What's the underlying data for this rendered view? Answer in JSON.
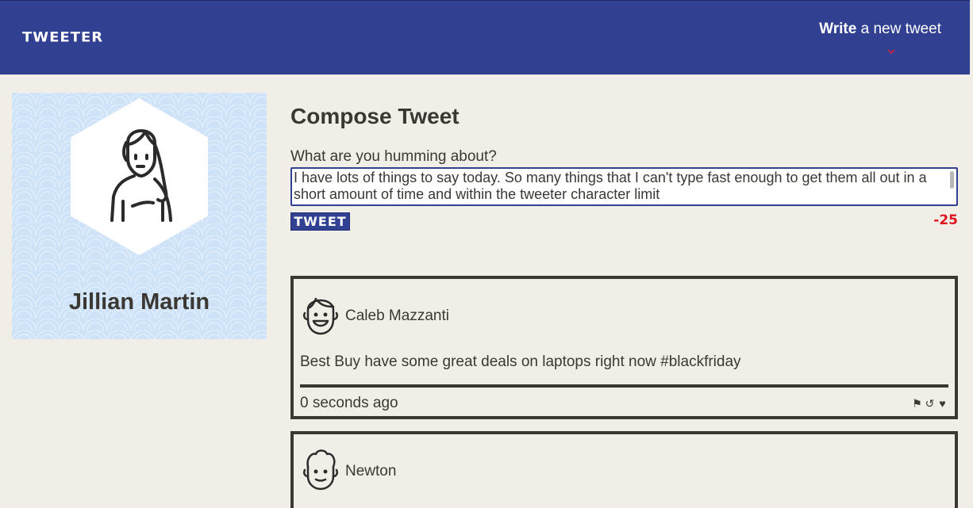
{
  "nav": {
    "brand": "TWEETER",
    "write_bold": "Write",
    "write_rest": " a new tweet",
    "write_icon": "chevron-down-icon"
  },
  "profile": {
    "name": "Jillian Martin",
    "avatar_icon": "woman-avatar-icon",
    "background_color": "#cfe3f8"
  },
  "compose": {
    "title": "Compose Tweet",
    "label": "What are you humming about?",
    "text": "I have lots of things to say today. So many things that I can't type fast enough to get them all out in a short amount of time and within the tweeter character limit",
    "button_label": "TWEET",
    "counter": "-25"
  },
  "tweets": [
    {
      "author": "Caleb Mazzanti",
      "avatar_icon": "smiling-man-avatar-icon",
      "content": "Best Buy have some great deals on laptops right now #blackfriday",
      "time": "0 seconds ago",
      "actions": [
        "flag-icon",
        "retweet-icon",
        "heart-icon"
      ]
    },
    {
      "author": "Newton",
      "avatar_icon": "curly-hair-man-avatar-icon"
    }
  ],
  "colors": {
    "header": "#324092",
    "background": "#f1ede7",
    "text": "#3b3833",
    "counter_negative": "#e0141e",
    "accent_chevron": "#d0203a"
  }
}
